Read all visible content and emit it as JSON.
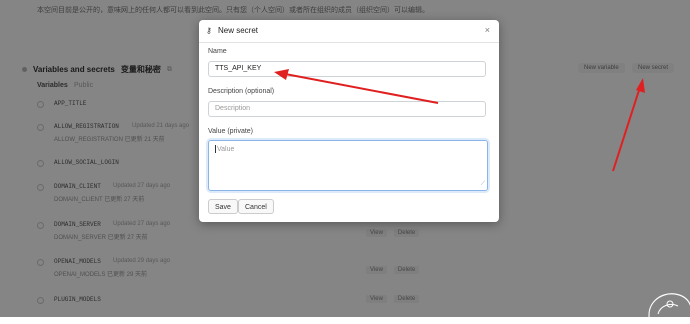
{
  "page": {
    "intro": "本空间目前是公开的，意味网上的任何人都可以看到此空间。只有您（个人空间）或者所在组织的成员（组织空间）可以编辑。",
    "section": {
      "title": "Variables and secrets",
      "subtitle": "变量和秘密",
      "variables_label": "Variables",
      "variables_hint": "Public",
      "new_variable": "New variable",
      "new_secret": "New secret"
    },
    "rows": [
      {
        "name": "APP_TITLE",
        "updated": "",
        "sub": ""
      },
      {
        "name": "ALLOW_REGISTRATION",
        "updated": "Updated 21 days ago",
        "sub": "ALLOW_REGISTRATION 已更新 21 天前"
      },
      {
        "name": "ALLOW_SOCIAL_LOGIN",
        "updated": "",
        "sub": ""
      },
      {
        "name": "DOMAIN_CLIENT",
        "updated": "Updated 27 days ago",
        "sub": "DOMAIN_CLIENT 已更新 27 天前"
      },
      {
        "name": "DOMAIN_SERVER",
        "updated": "Updated 27 days ago",
        "sub": "DOMAIN_SERVER 已更新 27 天前"
      },
      {
        "name": "OPENAI_MODELS",
        "updated": "Updated 29 days ago",
        "sub": "OPENAI_MODELS 已更新 29 天前"
      },
      {
        "name": "PLUGIN_MODELS",
        "updated": "",
        "sub": ""
      }
    ],
    "row_actions": {
      "view": "View",
      "delete": "Delete"
    }
  },
  "modal": {
    "title": "New secret",
    "name_label": "Name",
    "name_value": "TTS_API_KEY",
    "description_label": "Description (optional)",
    "description_placeholder": "Description",
    "value_label": "Value (private)",
    "value_placeholder": "Value",
    "save": "Save",
    "cancel": "Cancel",
    "close_icon": "×"
  },
  "annotation_color": "#e02020"
}
